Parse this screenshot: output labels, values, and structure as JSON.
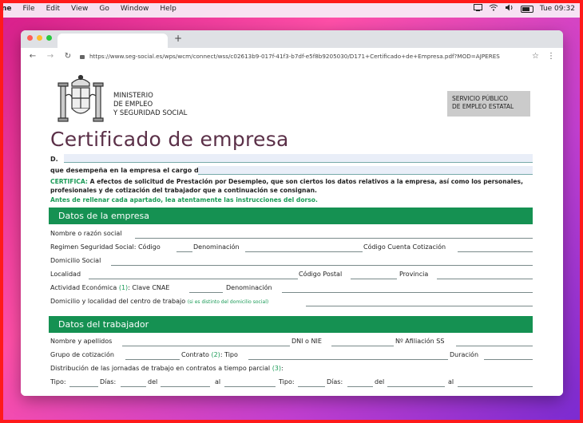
{
  "menubar": {
    "app": "ne",
    "items": [
      "File",
      "Edit",
      "View",
      "Go",
      "Window",
      "Help"
    ],
    "clock": "Tue 09:32"
  },
  "browser": {
    "new_tab_label": "+",
    "back_icon": "arrow-left-icon",
    "url": "https://www.seg-social.es/wps/wcm/connect/wss/c02613b9-017f-41f3-b7df-e5f8b9205030/D171+Certificado+de+Empresa.pdf?MOD=AJPERES"
  },
  "header": {
    "ministry_lines": [
      "MINISTERIO",
      "DE EMPLEO",
      "Y SEGURIDAD SOCIAL"
    ],
    "servicio_lines": [
      "SERVICIO PÚBLICO",
      "DE EMPLEO ESTATAL"
    ],
    "title": "Certificado de empresa"
  },
  "intro": {
    "d_label": "D.",
    "cargo_label": "que desempeña en la empresa el cargo de",
    "certifica_label": "CERTIFICA:",
    "certifica_text": "A efectos de solicitud de Prestación por Desempleo, que son ciertos los datos relativos a la empresa, así como los personales, profesionales y de cotización del trabajador que a continuación se consignan.",
    "instructions": "Antes de rellenar cada apartado, lea  atentamente las instrucciones del dorso."
  },
  "empresa": {
    "heading": "Datos de la empresa",
    "nombre": "Nombre o razón social",
    "regimen": "Regimen Seguridad Social: Código",
    "denominacion": "Denominación",
    "codigo_cuenta": "Código Cuenta Cotización",
    "domicilio": "Domicilio Social",
    "localidad": "Localidad",
    "codigo_postal": "Código Postal",
    "provincia": "Provincia",
    "actividad": "Actividad Económica",
    "actividad_ref": "(1)",
    "clave_cnae": ": Clave CNAE",
    "denominacion2": "Denominación",
    "centro": "Domicilio y localidad del centro de trabajo",
    "centro_note": "(si es distinto del domicilio social)"
  },
  "trabajador": {
    "heading": "Datos del trabajador",
    "nombre": "Nombre y apellidos",
    "dni": "DNI o NIE",
    "afiliacion": "Nº  Afiliación SS",
    "grupo": "Grupo de cotización",
    "contrato": "Contrato",
    "contrato_ref": "(2)",
    "tipo": ": Tipo",
    "duracion": "Duración",
    "distribucion": "Distribución de las jornadas de trabajo en contratos a tiempo parcial",
    "distribucion_ref": "(3)",
    "distribucion_colon": ":",
    "tipo_lbl": "Tipo:",
    "dias_lbl": "Días:",
    "del_lbl": "del",
    "al_lbl": "al"
  },
  "colors": {
    "section_green": "#159152",
    "accent_green": "#1a9a56",
    "title_color": "#5b3048"
  }
}
